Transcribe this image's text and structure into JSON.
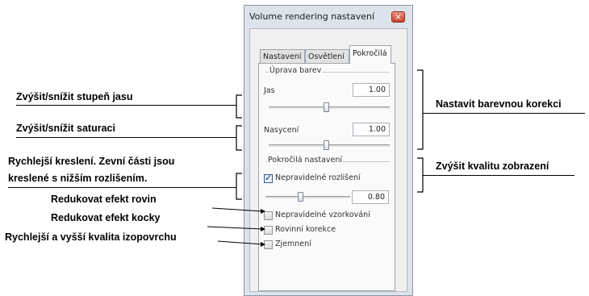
{
  "window": {
    "title": "Volume rendering nastavení",
    "tabs": [
      "Nastavení",
      "Osvětlení",
      "Pokročilá"
    ],
    "active_tab": "Pokročilá",
    "color_group": {
      "title": "Úprava barev",
      "brightness": {
        "label": "Jas",
        "value": "1.00",
        "slider_fraction": 0.5
      },
      "saturation": {
        "label": "Nasycení",
        "value": "1.00",
        "slider_fraction": 0.5
      }
    },
    "advanced_group": {
      "title": "Pokročilá nastavení",
      "irregular_resolution": {
        "label": "Nepravidelné rozlišení",
        "checked": true,
        "value": "0.80",
        "slider_fraction": 0.4
      },
      "irregular_sampling": {
        "label": "Nepravidelné vzorkování",
        "checked": false
      },
      "plane_correction": {
        "label": "Rovinní korekce",
        "checked": false
      },
      "smoothing": {
        "label": "Zjemnení",
        "checked": false
      }
    }
  },
  "annotations": {
    "brightness": "Zvýšit/snížit stupeň jasu",
    "saturation": "Zvýšit/snížit saturaci",
    "fast_render_line1": "Rychlejší kreslení. Zevní části jsou",
    "fast_render_line2": "kreslené s nižším rozlišením.",
    "plane_effect": "Redukovat efekt rovin",
    "cube_effect": "Redukovat efekt kocky",
    "isosurface": "Rychlejší a vyšší kvalita izopovrchu",
    "color_correction": "Nastavit barevnou korekci",
    "display_quality": "Zvýšit kvalitu zobrazení"
  }
}
